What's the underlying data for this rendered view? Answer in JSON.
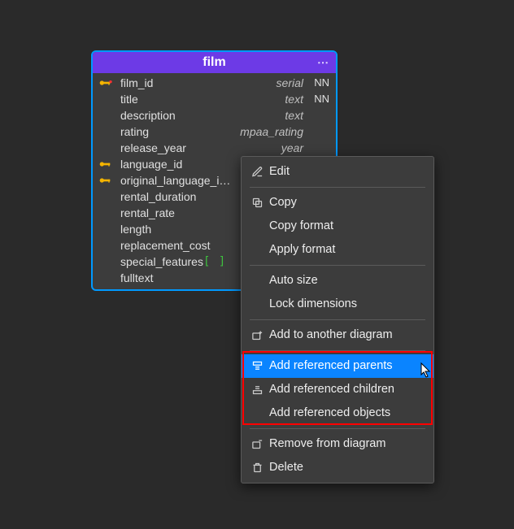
{
  "table": {
    "name": "film",
    "columns": [
      {
        "key": "pk",
        "name": "film_id",
        "type": "serial",
        "nn": "NN",
        "extra": ""
      },
      {
        "key": "",
        "name": "title",
        "type": "text",
        "nn": "NN",
        "extra": ""
      },
      {
        "key": "",
        "name": "description",
        "type": "text",
        "nn": "",
        "extra": ""
      },
      {
        "key": "",
        "name": "rating",
        "type": "mpaa_rating",
        "nn": "",
        "extra": ""
      },
      {
        "key": "",
        "name": "release_year",
        "type": "year",
        "nn": "",
        "extra": ""
      },
      {
        "key": "fk",
        "name": "language_id",
        "type": "",
        "nn": "",
        "extra": ""
      },
      {
        "key": "fk",
        "name": "original_language_i…",
        "type": "",
        "nn": "",
        "extra": ""
      },
      {
        "key": "",
        "name": "rental_duration",
        "type": "",
        "nn": "",
        "extra": ""
      },
      {
        "key": "",
        "name": "rental_rate",
        "type": "",
        "nn": "",
        "extra": ""
      },
      {
        "key": "",
        "name": "length",
        "type": "",
        "nn": "",
        "extra": ""
      },
      {
        "key": "",
        "name": "replacement_cost",
        "type": "",
        "nn": "",
        "extra": ""
      },
      {
        "key": "",
        "name": "special_features",
        "type": "",
        "nn": "",
        "extra": "array"
      },
      {
        "key": "",
        "name": "fulltext",
        "type": "",
        "nn": "",
        "extra": ""
      }
    ]
  },
  "menu": {
    "edit": "Edit",
    "copy": "Copy",
    "copy_format": "Copy format",
    "apply_format": "Apply format",
    "auto_size": "Auto size",
    "lock_dims": "Lock dimensions",
    "add_diagram": "Add to another diagram",
    "add_parents": "Add referenced parents",
    "add_children": "Add referenced children",
    "add_objects": "Add referenced objects",
    "remove_diagram": "Remove from diagram",
    "delete": "Delete"
  }
}
